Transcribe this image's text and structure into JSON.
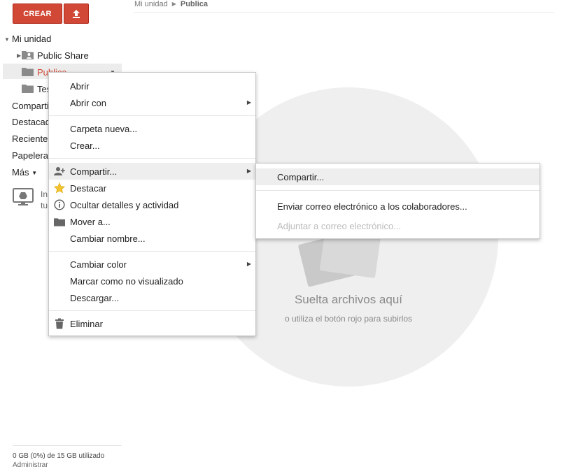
{
  "toolbar": {
    "create_label": "CREAR"
  },
  "breadcrumb": {
    "root": "Mi unidad",
    "current": "Publica"
  },
  "sidebar": {
    "root_label": "Mi unidad",
    "folders": [
      {
        "label": "Public Share"
      },
      {
        "label": "Publica"
      },
      {
        "label": "Tes"
      }
    ],
    "items": [
      {
        "label": "Comparti"
      },
      {
        "label": "Destacad"
      },
      {
        "label": "Reciente"
      },
      {
        "label": "Papelera"
      },
      {
        "label": "Más"
      }
    ],
    "install_lines": [
      "In",
      "tu"
    ]
  },
  "context_menu": {
    "items": [
      {
        "label": "Abrir"
      },
      {
        "label": "Abrir con"
      },
      {
        "label": "Carpeta nueva..."
      },
      {
        "label": "Crear..."
      },
      {
        "label": "Compartir..."
      },
      {
        "label": "Destacar"
      },
      {
        "label": "Ocultar detalles y actividad"
      },
      {
        "label": "Mover a..."
      },
      {
        "label": "Cambiar nombre..."
      },
      {
        "label": "Cambiar color"
      },
      {
        "label": "Marcar como no visualizado"
      },
      {
        "label": "Descargar..."
      },
      {
        "label": "Eliminar"
      }
    ]
  },
  "share_submenu": {
    "items": [
      {
        "label": "Compartir..."
      },
      {
        "label": "Enviar correo electrónico a los colaboradores..."
      },
      {
        "label": "Adjuntar a correo electrónico..."
      }
    ]
  },
  "dropzone": {
    "title": "Suelta archivos aquí",
    "subtitle": "o utiliza el botón rojo para subirlos"
  },
  "storage": {
    "usage": "0 GB (0%) de 15 GB utilizado",
    "admin": "Administrar"
  },
  "colors": {
    "brand_red": "#d14836",
    "selected_folder_text": "#d14836",
    "disabled_text": "#bbbbbb"
  }
}
